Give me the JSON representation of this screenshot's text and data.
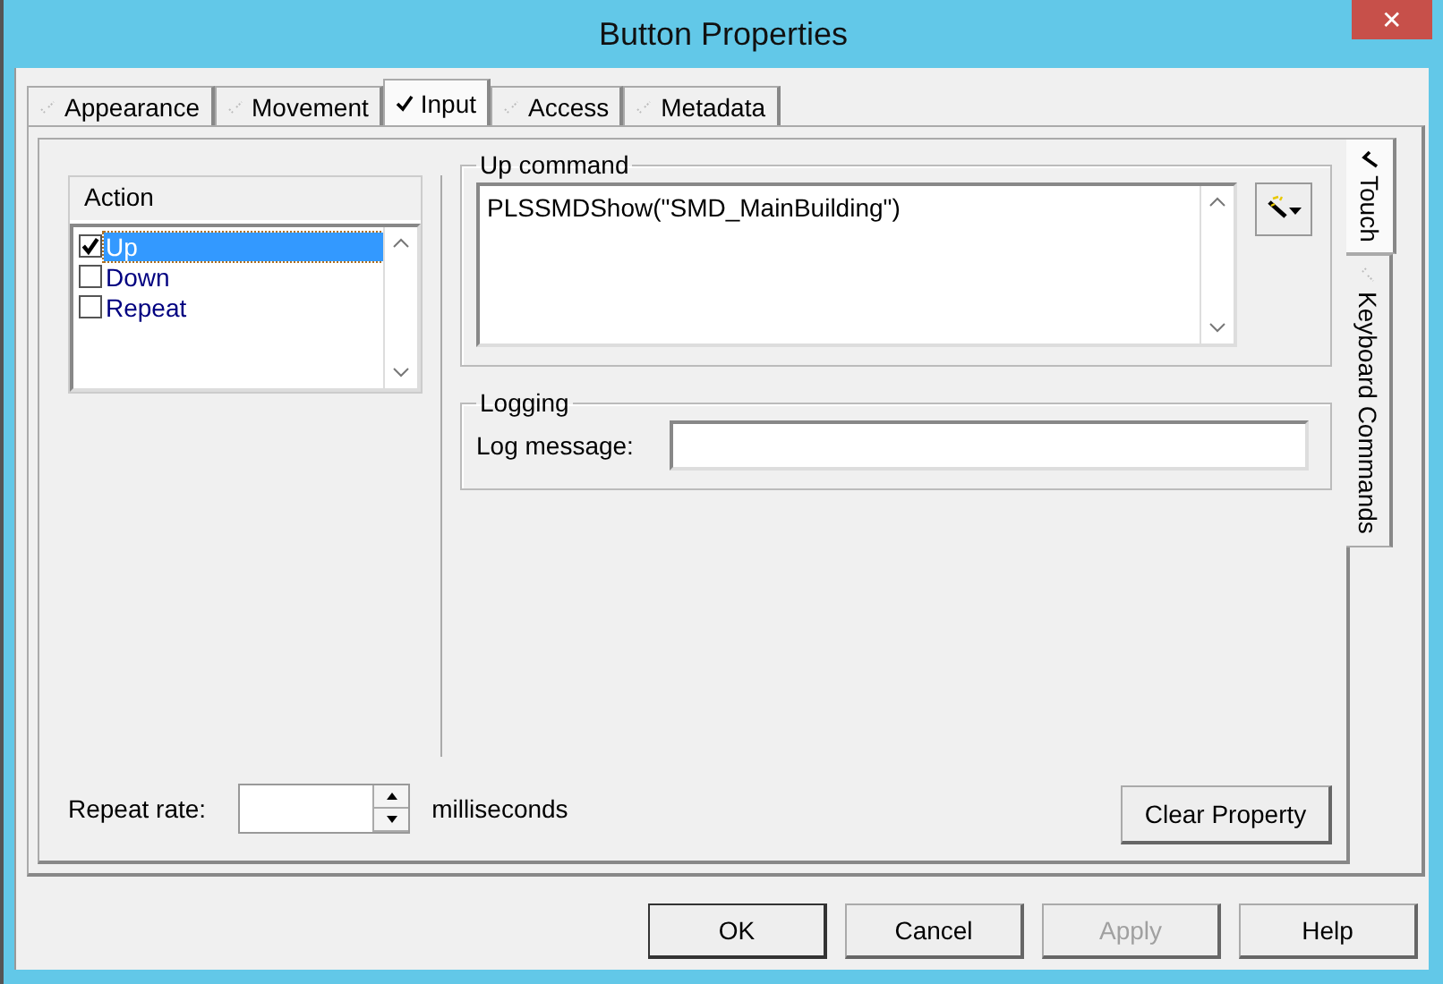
{
  "window": {
    "title": "Button Properties",
    "close": "✕"
  },
  "tabs": [
    {
      "label": "Appearance",
      "selected": false
    },
    {
      "label": "Movement",
      "selected": false
    },
    {
      "label": "Input",
      "selected": true
    },
    {
      "label": "Access",
      "selected": false
    },
    {
      "label": "Metadata",
      "selected": false
    }
  ],
  "side_tabs": [
    {
      "label": "Touch",
      "selected": true
    },
    {
      "label": "Keyboard Commands",
      "selected": false
    }
  ],
  "action_list": {
    "header": "Action",
    "items": [
      {
        "label": "Up",
        "checked": true,
        "selected": true
      },
      {
        "label": "Down",
        "checked": false,
        "selected": false
      },
      {
        "label": "Repeat",
        "checked": false,
        "selected": false
      }
    ]
  },
  "up_command": {
    "title": "Up command",
    "value": "PLSSMDShow(\"SMD_MainBuilding\")"
  },
  "logging": {
    "title": "Logging",
    "label": "Log message:"
  },
  "repeat_rate": {
    "label": "Repeat rate:",
    "unit": "milliseconds"
  },
  "clear_button": "Clear Property",
  "buttons": [
    {
      "label": "OK",
      "default": true,
      "disabled": false
    },
    {
      "label": "Cancel",
      "default": false,
      "disabled": false
    },
    {
      "label": "Apply",
      "default": false,
      "disabled": true
    },
    {
      "label": "Help",
      "default": false,
      "disabled": false
    }
  ]
}
